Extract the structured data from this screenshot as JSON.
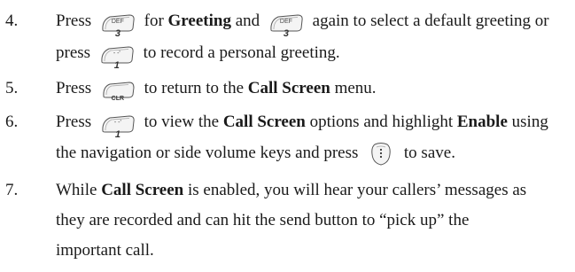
{
  "steps": [
    {
      "number": "4.",
      "line1": {
        "t1": "Press",
        "t2": "for",
        "b1": "Greeting",
        "t3": "and",
        "t4": "again to select a default greeting or"
      },
      "line2": {
        "t1": "press",
        "t2": "to record a personal greeting."
      }
    },
    {
      "number": "5.",
      "line1": {
        "t1": "Press",
        "t2": "to return to the",
        "b1": "Call Screen",
        "t3": "menu."
      }
    },
    {
      "number": "6.",
      "line1": {
        "t1": "Press",
        "t2": "to view the",
        "b1": "Call Screen",
        "t3": "options and highlight",
        "b2": "Enable",
        "t4": "using"
      },
      "line2": {
        "t1": "the navigation or side volume keys and press",
        "t2": "to save."
      }
    },
    {
      "number": "7.",
      "line1": {
        "t1": "While",
        "b1": "Call Screen",
        "t2": "is enabled, you will hear your callers’ messages as"
      },
      "line2": "they are recorded and can hit the send button to “pick up” the",
      "line3": "important call."
    }
  ],
  "keys": {
    "key3": {
      "main": "3",
      "sup": "DEF",
      "icon": "key-3-icon"
    },
    "key1": {
      "main": "1",
      "sup": "- -'",
      "icon": "key-1-icon"
    },
    "clr": {
      "main": "CLR",
      "icon": "clr-key-icon"
    },
    "menu_ok": {
      "icon": "menu-ok-key-icon"
    }
  }
}
